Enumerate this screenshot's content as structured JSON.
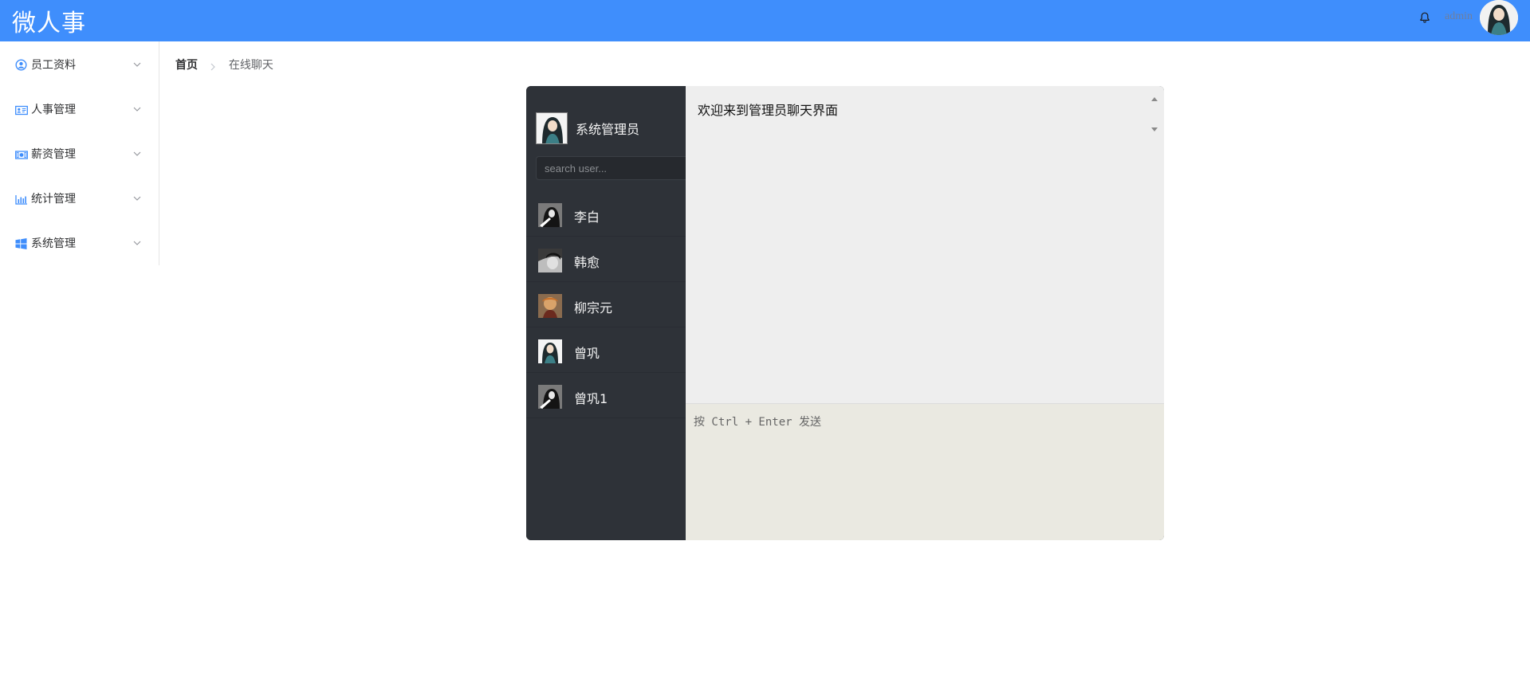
{
  "header": {
    "logo": "微人事",
    "username": "admin",
    "colors": {
      "bar": "#3f8efc",
      "text": "#ffffff"
    },
    "icons": {
      "notifications": "bell-icon"
    }
  },
  "sidebar": {
    "items": [
      {
        "label": "员工资料",
        "icon": "user-circle-icon"
      },
      {
        "label": "人事管理",
        "icon": "id-card-icon"
      },
      {
        "label": "薪资管理",
        "icon": "money-icon"
      },
      {
        "label": "统计管理",
        "icon": "bar-chart-icon"
      },
      {
        "label": "系统管理",
        "icon": "windows-icon"
      }
    ],
    "accent": "#3f8efc"
  },
  "breadcrumb": {
    "home": "首页",
    "current": "在线聊天"
  },
  "chat": {
    "self_name": "系统管理员",
    "search_placeholder": "search user...",
    "users": [
      {
        "name": "李白"
      },
      {
        "name": "韩愈"
      },
      {
        "name": "柳宗元"
      },
      {
        "name": "曾巩"
      },
      {
        "name": "曾巩1"
      }
    ],
    "welcome": "欢迎来到管理员聊天界面",
    "input_placeholder": "按 Ctrl + Enter 发送"
  }
}
